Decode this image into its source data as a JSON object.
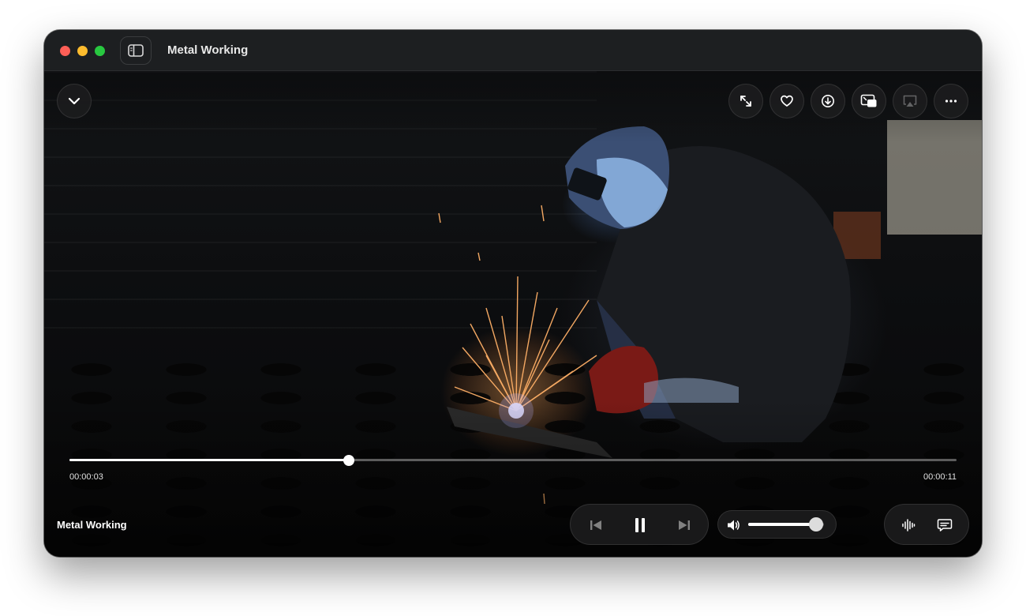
{
  "window": {
    "title": "Metal Working"
  },
  "player": {
    "video_title": "Metal Working",
    "current_time": "00:00:03",
    "duration": "00:00:11",
    "progress": 0.315,
    "volume": 0.9,
    "state": "playing"
  },
  "top_controls": [
    {
      "icon": "collapse-chevron-icon"
    },
    {
      "icon": "fullscreen-icon"
    },
    {
      "icon": "heart-icon"
    },
    {
      "icon": "download-icon"
    },
    {
      "icon": "picture-in-picture-icon"
    },
    {
      "icon": "airplay-icon"
    },
    {
      "icon": "more-icon"
    }
  ],
  "colors": {
    "close": "#fe5f57",
    "minimize": "#febc2e",
    "zoom": "#28c840",
    "control_bg": "#1c1c1e"
  }
}
